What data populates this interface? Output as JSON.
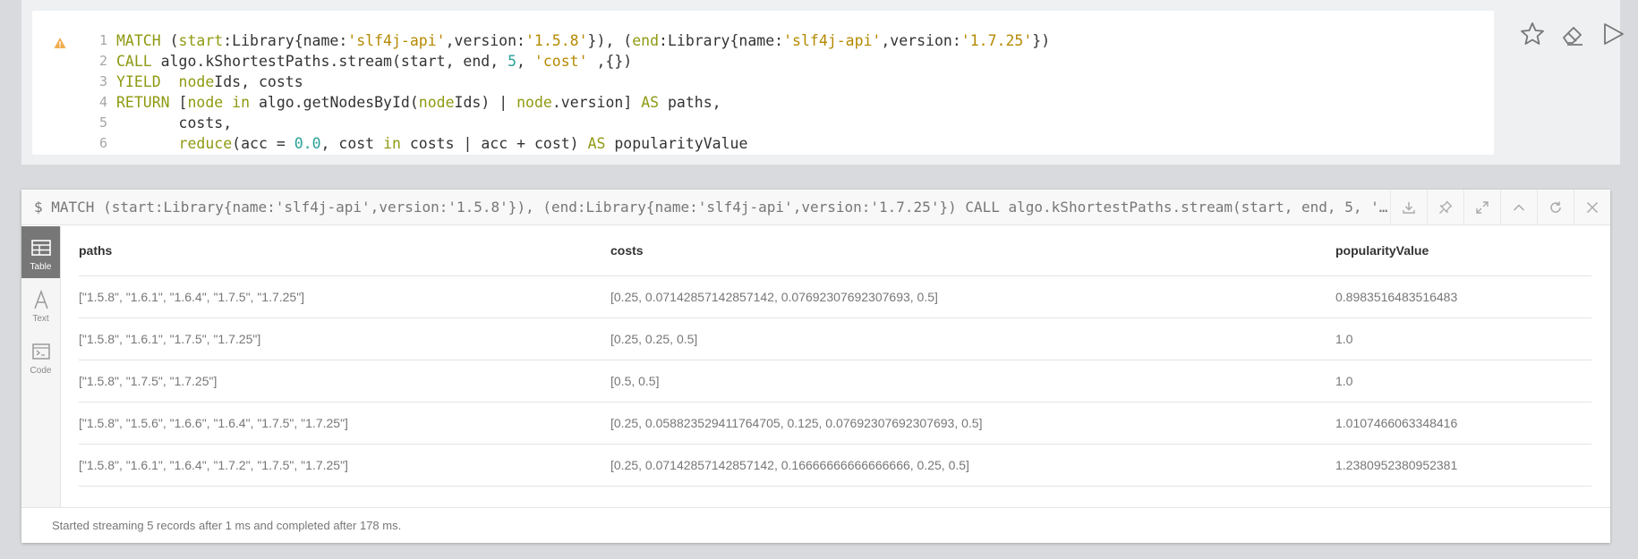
{
  "editor": {
    "line_numbers": [
      "1",
      "2",
      "3",
      "4",
      "5",
      "6"
    ],
    "lines": [
      [
        [
          "kw",
          "MATCH"
        ],
        [
          "pln",
          " ("
        ],
        [
          "var",
          "start"
        ],
        [
          "pln",
          ":Library{name:"
        ],
        [
          "str",
          "'slf4j-api'"
        ],
        [
          "pln",
          ",version:"
        ],
        [
          "str",
          "'1.5.8'"
        ],
        [
          "pln",
          "}), ("
        ],
        [
          "var",
          "end"
        ],
        [
          "pln",
          ":Library{name:"
        ],
        [
          "str",
          "'slf4j-api'"
        ],
        [
          "pln",
          ",version:"
        ],
        [
          "str",
          "'1.7.25'"
        ],
        [
          "pln",
          "})"
        ]
      ],
      [
        [
          "kw",
          "CALL"
        ],
        [
          "pln",
          " algo.kShortestPaths.stream(start, end, "
        ],
        [
          "num",
          "5"
        ],
        [
          "pln",
          ", "
        ],
        [
          "str",
          "'cost'"
        ],
        [
          "pln",
          " ,{})"
        ]
      ],
      [
        [
          "kw",
          "YIELD"
        ],
        [
          "pln",
          "  "
        ],
        [
          "var",
          "node"
        ],
        [
          "pln",
          "Ids, costs"
        ]
      ],
      [
        [
          "kw",
          "RETURN"
        ],
        [
          "pln",
          " ["
        ],
        [
          "var",
          "node"
        ],
        [
          "pln",
          " "
        ],
        [
          "kw",
          "in"
        ],
        [
          "pln",
          " algo.getNodesById("
        ],
        [
          "var",
          "node"
        ],
        [
          "pln",
          "Ids) | "
        ],
        [
          "var",
          "node"
        ],
        [
          "pln",
          ".version] "
        ],
        [
          "kw",
          "AS"
        ],
        [
          "pln",
          " paths,"
        ]
      ],
      [
        [
          "pln",
          "       costs,"
        ]
      ],
      [
        [
          "pln",
          "       "
        ],
        [
          "kw",
          "reduce"
        ],
        [
          "pln",
          "(acc = "
        ],
        [
          "num",
          "0.0"
        ],
        [
          "pln",
          ", cost "
        ],
        [
          "kw",
          "in"
        ],
        [
          "pln",
          " costs | acc + cost) "
        ],
        [
          "kw",
          "AS"
        ],
        [
          "pln",
          " popularityValue"
        ]
      ]
    ],
    "warning_icon": "warning-triangle-icon",
    "actions": [
      "star-icon",
      "eraser-icon",
      "play-icon"
    ]
  },
  "frame": {
    "command": "$ MATCH (start:Library{name:'slf4j-api',version:'1.5.8'}), (end:Library{name:'slf4j-api',version:'1.7.25'}) CALL algo.kShortestPaths.stream(start, end, 5, 'cost' ,{}) YIELD nodeIds, costs RETURN [node in algo.getNodesById(nodeIds) | node.version] AS paths, costs, reduce(acc = 0.0, cost in costs | acc + cost) AS popularityValue",
    "buttons": [
      "download-icon",
      "pin-icon",
      "expand-icon",
      "collapse-icon",
      "rerun-icon",
      "close-icon"
    ],
    "tabs": [
      {
        "label": "Table",
        "icon": "table-icon",
        "active": true
      },
      {
        "label": "Text",
        "icon": "text-icon",
        "active": false
      },
      {
        "label": "Code",
        "icon": "code-icon",
        "active": false
      }
    ],
    "table": {
      "headers": [
        "paths",
        "costs",
        "popularityValue"
      ],
      "rows": [
        [
          "[\"1.5.8\", \"1.6.1\", \"1.6.4\", \"1.7.5\", \"1.7.25\"]",
          "[0.25, 0.07142857142857142, 0.07692307692307693, 0.5]",
          "0.8983516483516483"
        ],
        [
          "[\"1.5.8\", \"1.6.1\", \"1.7.5\", \"1.7.25\"]",
          "[0.25, 0.25, 0.5]",
          "1.0"
        ],
        [
          "[\"1.5.8\", \"1.7.5\", \"1.7.25\"]",
          "[0.5, 0.5]",
          "1.0"
        ],
        [
          "[\"1.5.8\", \"1.5.6\", \"1.6.6\", \"1.6.4\", \"1.7.5\", \"1.7.25\"]",
          "[0.25, 0.058823529411764705, 0.125, 0.07692307692307693, 0.5]",
          "1.0107466063348416"
        ],
        [
          "[\"1.5.8\", \"1.6.1\", \"1.6.4\", \"1.7.2\", \"1.7.5\", \"1.7.25\"]",
          "[0.25, 0.07142857142857142, 0.16666666666666666, 0.25, 0.5]",
          "1.2380952380952381"
        ]
      ]
    },
    "status": "Started streaming 5 records after 1 ms and completed after 178 ms."
  },
  "colors": {
    "keyword": "#8f9a12",
    "string": "#b58900",
    "number": "#2aa198",
    "warning": "#f0ad4e"
  }
}
